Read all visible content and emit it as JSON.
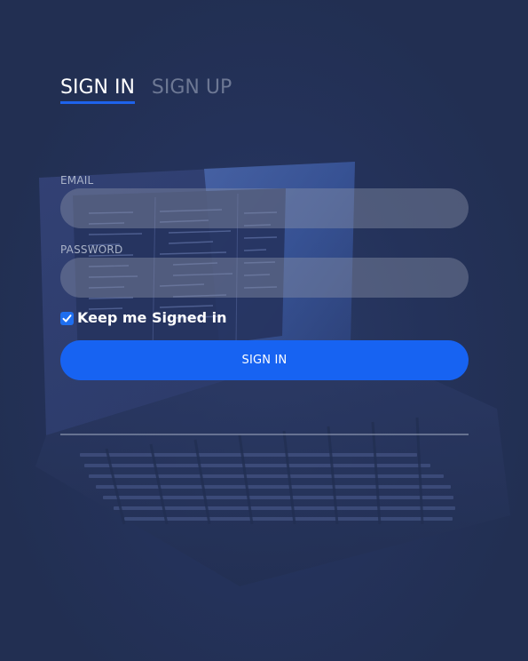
{
  "tabs": {
    "sign_in_label": "SIGN IN",
    "sign_up_label": "SIGN UP"
  },
  "form": {
    "email_label": "EMAIL",
    "email_value": "",
    "password_label": "PASSWORD",
    "password_value": "",
    "remember_label": "Keep me Signed in",
    "remember_checked": true,
    "submit_label": "SIGN IN"
  },
  "colors": {
    "background": "#222f52",
    "accent": "#1763f2",
    "field_fill": "#8c94aa",
    "inactive_tab": "#6d7894"
  },
  "background_image": "laptop-with-code-editor"
}
